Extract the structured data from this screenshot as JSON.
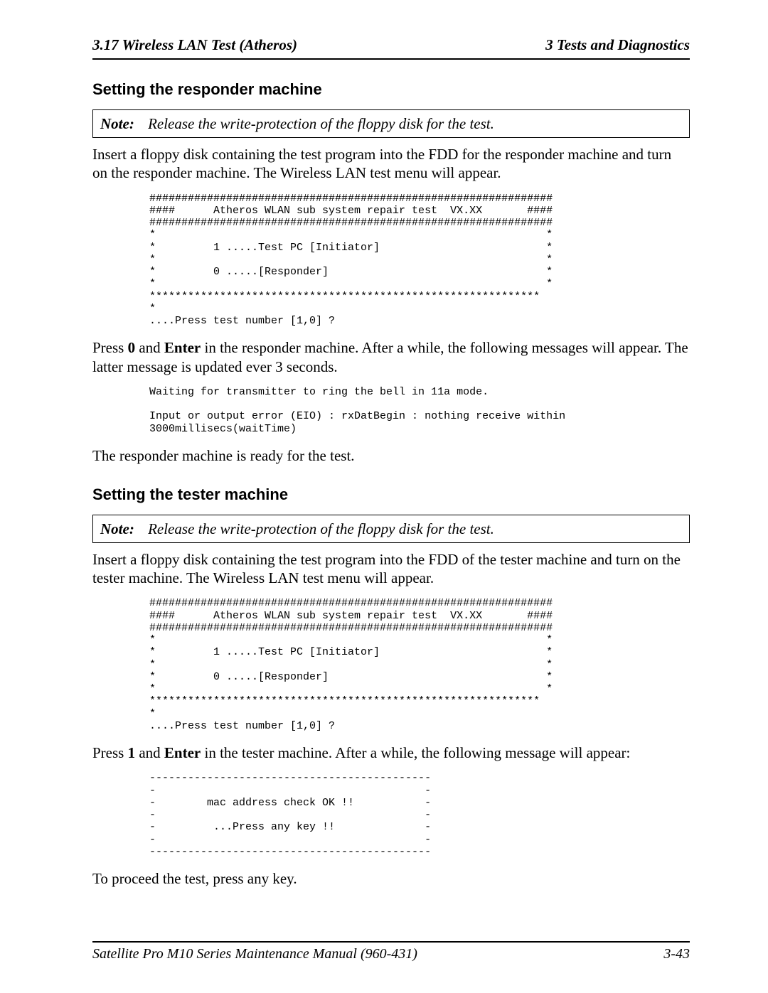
{
  "header": {
    "left": "3.17  Wireless LAN Test  (Atheros)",
    "right": "3   Tests and Diagnostics"
  },
  "section1": {
    "title": "Setting the responder machine",
    "note_label": "Note:",
    "note_text": "Release the write-protection of the floppy disk for the test.",
    "para": "Insert a floppy disk containing the test program into the FDD for the responder machine and turn on the responder machine. The Wireless LAN test menu will appear.",
    "code": "###############################################################\n####      Atheros WLAN sub system repair test  VX.XX       ####\n###############################################################\n*                                                             *\n*         1 .....Test PC [Initiator]                          *\n*                                                             *\n*         0 .....[Responder]                                  *\n*                                                             *\n*************************************************************\n*\n....Press test number [1,0] ?",
    "para2_pre": "Press ",
    "para2_b1": "0",
    "para2_mid": " and ",
    "para2_b2": "Enter",
    "para2_post": " in the responder machine. After a while, the following messages will appear. The latter message is updated ever 3 seconds.",
    "code2": "Waiting for transmitter to ring the bell in 11a mode.\n\nInput or output error (EIO) : rxDatBegin : nothing receive within\n3000millisecs(waitTime)",
    "para3": "The responder machine is ready for the test."
  },
  "section2": {
    "title": "Setting the tester machine",
    "note_label": "Note:",
    "note_text": "Release the write-protection of the floppy disk for the test.",
    "para": "Insert a floppy disk containing the test program into the FDD of the tester machine and turn on the tester machine. The Wireless LAN test menu will appear.",
    "code": "###############################################################\n####      Atheros WLAN sub system repair test  VX.XX       ####\n###############################################################\n*                                                             *\n*         1 .....Test PC [Initiator]                          *\n*                                                             *\n*         0 .....[Responder]                                  *\n*                                                             *\n*************************************************************\n*\n....Press test number [1,0] ?",
    "para2_pre": "Press ",
    "para2_b1": "1",
    "para2_mid": " and ",
    "para2_b2": "Enter",
    "para2_post": " in the tester machine. After a while, the following message will appear:",
    "code2": "--------------------------------------------\n-                                          -\n-        mac address check OK !!           -\n-                                          -\n-         ...Press any key !!              -\n-                                          -\n--------------------------------------------",
    "para3": "To proceed the test, press any key."
  },
  "footer": {
    "left": "Satellite Pro M10 Series Maintenance Manual (960-431)",
    "right": "3-43"
  }
}
